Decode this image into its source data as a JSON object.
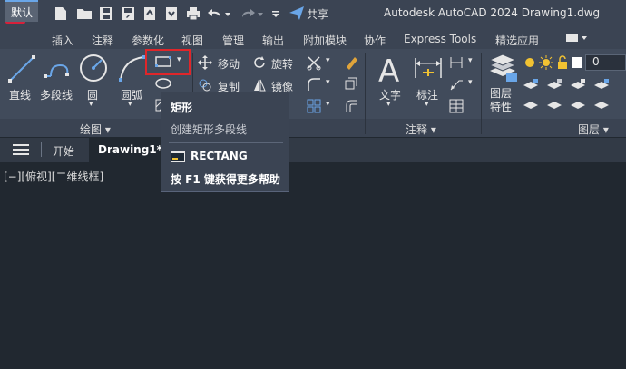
{
  "titlebar": {
    "app_logo": "A",
    "share_label": "共享",
    "window_title": "Autodesk AutoCAD 2024    Drawing1.dwg"
  },
  "tabs": [
    {
      "label": "默认",
      "active": true
    },
    {
      "label": "插入"
    },
    {
      "label": "注释"
    },
    {
      "label": "参数化"
    },
    {
      "label": "视图"
    },
    {
      "label": "管理"
    },
    {
      "label": "输出"
    },
    {
      "label": "附加模块"
    },
    {
      "label": "协作"
    },
    {
      "label": "Express Tools"
    },
    {
      "label": "精选应用"
    }
  ],
  "draw_panel": {
    "line": "直线",
    "polyline": "多段线",
    "circle": "圆",
    "arc": "圆弧",
    "label": "绘图 ▾"
  },
  "modify_panel": {
    "move": "移动",
    "rotate": "旋转",
    "copy": "复制",
    "mirror": "镜像"
  },
  "annotation_panel": {
    "text": "文字",
    "dimension": "标注",
    "label": "注释 ▾"
  },
  "layers_panel": {
    "layer_properties": "图层\n特性",
    "layer_name": "0",
    "label": "图层 ▾"
  },
  "filetabs": {
    "start": "开始",
    "drawing": "Drawing1*"
  },
  "viewport": {
    "label": "[−][俯视][二维线框]"
  },
  "tooltip": {
    "title": "矩形",
    "description": "创建矩形多段线",
    "command": "RECTANG",
    "help": "按 F1 键获得更多帮助"
  },
  "colors": {
    "titlebar": "#3b4453",
    "ribbon": "#414b5b",
    "canvas": "#212830",
    "accent_red": "#e0262a",
    "logo_red": "#d7203a"
  }
}
